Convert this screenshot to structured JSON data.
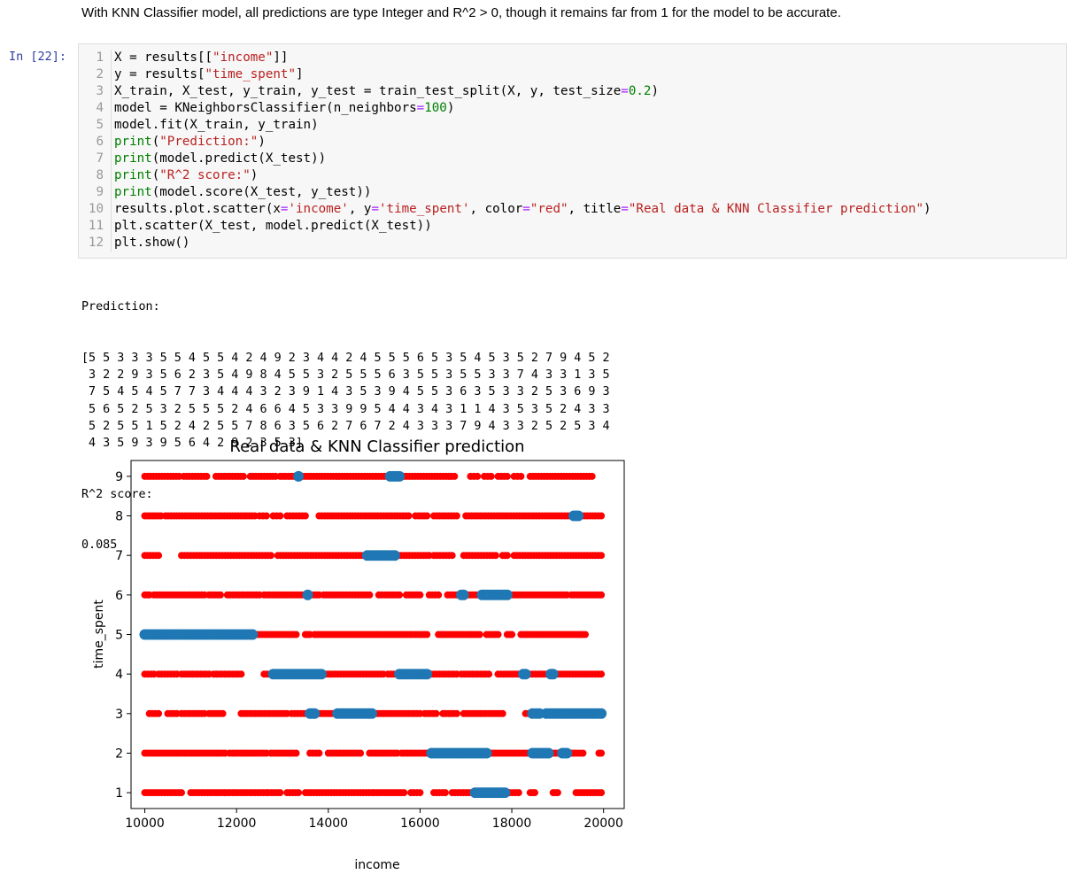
{
  "markdown": {
    "text": "With KNN Classifier model, all predictions are type Integer and R^2 > 0, though it remains far from 1 for the model to be accurate."
  },
  "cell": {
    "prompt": "In [22]:",
    "code_lines": [
      [
        [
          "X = results[[",
          ""
        ],
        [
          "\"income\"",
          "str"
        ],
        [
          "]]",
          ""
        ]
      ],
      [
        [
          "y = results[",
          ""
        ],
        [
          "\"time_spent\"",
          "str"
        ],
        [
          "]",
          ""
        ]
      ],
      [
        [
          "X_train, X_test, y_train, y_test = train_test_split(X, y, test_size",
          ""
        ],
        [
          "=",
          "op"
        ],
        [
          "0.2",
          "num"
        ],
        [
          ")",
          ""
        ]
      ],
      [
        [
          "model = KNeighborsClassifier(n_neighbors",
          ""
        ],
        [
          "=",
          "op"
        ],
        [
          "100",
          "num"
        ],
        [
          ")",
          ""
        ]
      ],
      [
        [
          "model.fit(X_train, y_train)",
          ""
        ]
      ],
      [
        [
          "print",
          "kw"
        ],
        [
          "(",
          ""
        ],
        [
          "\"Prediction:\"",
          "str"
        ],
        [
          ")",
          ""
        ]
      ],
      [
        [
          "print",
          "kw"
        ],
        [
          "(model.predict(X_test))",
          ""
        ]
      ],
      [
        [
          "print",
          "kw"
        ],
        [
          "(",
          ""
        ],
        [
          "\"R^2 score:\"",
          "str"
        ],
        [
          ")",
          ""
        ]
      ],
      [
        [
          "print",
          "kw"
        ],
        [
          "(model.score(X_test, y_test))",
          ""
        ]
      ],
      [
        [
          "results.plot.scatter(x",
          ""
        ],
        [
          "=",
          "op"
        ],
        [
          "'income'",
          "str"
        ],
        [
          ", y",
          ""
        ],
        [
          "=",
          "op"
        ],
        [
          "'time_spent'",
          "str"
        ],
        [
          ", color",
          ""
        ],
        [
          "=",
          "op"
        ],
        [
          "\"red\"",
          "str"
        ],
        [
          ", title",
          ""
        ],
        [
          "=",
          "op"
        ],
        [
          "\"Real data & KNN Classifier prediction\"",
          "str"
        ],
        [
          ")",
          ""
        ]
      ],
      [
        [
          "plt.scatter(X_test, model.predict(X_test))",
          ""
        ]
      ],
      [
        [
          "plt.show()",
          ""
        ]
      ]
    ]
  },
  "output": {
    "label1": "Prediction:",
    "prediction_lines": [
      "[5 5 3 3 3 5 5 4 5 5 4 2 4 9 2 3 4 4 2 4 5 5 5 6 5 3 5 4 5 3 5 2 7 9 4 5 2",
      " 3 2 2 9 3 5 6 2 3 5 4 9 8 4 5 5 3 2 5 5 5 6 3 5 5 3 5 5 3 3 7 4 3 3 1 3 5",
      " 7 5 4 5 4 5 7 7 3 4 4 4 3 2 3 9 1 4 3 5 3 9 4 5 5 3 6 3 5 3 3 2 5 3 6 9 3",
      " 5 6 5 2 5 3 2 5 5 5 2 4 6 6 4 5 3 3 9 9 5 4 4 3 4 3 1 1 4 3 5 3 5 2 4 3 3",
      " 5 2 5 5 1 5 2 4 2 5 5 7 8 6 3 5 6 2 7 6 7 2 4 3 3 3 7 9 4 3 3 2 5 2 5 3 4",
      " 4 3 5 9 3 9 5 6 4 2 9 2 3 5 3]"
    ],
    "label2": "R^2 score:",
    "score": "0.085"
  },
  "chart_data": {
    "type": "scatter",
    "title": "Real data & KNN Classifier prediction",
    "xlabel": "income",
    "ylabel": "time_spent",
    "xlim": [
      9700,
      20450
    ],
    "ylim": [
      0.6,
      9.4
    ],
    "xticks": [
      "10000",
      "12000",
      "14000",
      "16000",
      "18000",
      "20000"
    ],
    "yticks": [
      "1",
      "2",
      "3",
      "4",
      "5",
      "6",
      "7",
      "8",
      "9"
    ],
    "grid": false,
    "series": [
      {
        "color": "#ff0000",
        "segments": [
          {
            "y": 9,
            "ranges": [
              [
                10000,
                10750
              ],
              [
                10850,
                11350
              ],
              [
                11550,
                12150
              ],
              [
                12300,
                12850
              ],
              [
                12950,
                16750
              ],
              [
                17100,
                17250
              ],
              [
                17400,
                17550
              ],
              [
                17700,
                17900
              ],
              [
                18050,
                18200
              ],
              [
                18400,
                19750
              ]
            ]
          },
          {
            "y": 8,
            "ranges": [
              [
                10000,
                10350
              ],
              [
                10450,
                12400
              ],
              [
                12500,
                12650
              ],
              [
                12800,
                12950
              ],
              [
                13100,
                13500
              ],
              [
                13800,
                15750
              ],
              [
                15900,
                16150
              ],
              [
                16300,
                16800
              ],
              [
                17000,
                19950
              ]
            ]
          },
          {
            "y": 7,
            "ranges": [
              [
                10000,
                10300
              ],
              [
                10800,
                11200
              ],
              [
                11250,
                12750
              ],
              [
                12900,
                13500
              ],
              [
                13550,
                16200
              ],
              [
                16300,
                16700
              ],
              [
                16950,
                17650
              ],
              [
                17800,
                17900
              ],
              [
                18050,
                19950
              ]
            ]
          },
          {
            "y": 6,
            "ranges": [
              [
                10000,
                10100
              ],
              [
                10200,
                11300
              ],
              [
                11400,
                11650
              ],
              [
                11800,
                12500
              ],
              [
                12600,
                13800
              ],
              [
                13900,
                14900
              ],
              [
                15100,
                15550
              ],
              [
                15700,
                16000
              ],
              [
                16200,
                16400
              ],
              [
                16600,
                19200
              ],
              [
                19300,
                19950
              ]
            ]
          },
          {
            "y": 5,
            "ranges": [
              [
                10000,
                13300
              ],
              [
                13500,
                13600
              ],
              [
                13700,
                16150
              ],
              [
                16400,
                17300
              ],
              [
                17450,
                17700
              ],
              [
                17900,
                18000
              ],
              [
                18200,
                19600
              ]
            ]
          },
          {
            "y": 4,
            "ranges": [
              [
                10000,
                10200
              ],
              [
                10300,
                10700
              ],
              [
                10800,
                11400
              ],
              [
                11500,
                12100
              ],
              [
                12600,
                15200
              ],
              [
                15300,
                16800
              ],
              [
                16900,
                17500
              ],
              [
                17700,
                19950
              ]
            ]
          },
          {
            "y": 3,
            "ranges": [
              [
                10100,
                10300
              ],
              [
                10500,
                10700
              ],
              [
                10800,
                11300
              ],
              [
                11400,
                11700
              ],
              [
                12100,
                13100
              ],
              [
                13200,
                13600
              ],
              [
                13700,
                16000
              ],
              [
                16100,
                16350
              ],
              [
                16500,
                16800
              ],
              [
                16950,
                17800
              ],
              [
                18300,
                19950
              ]
            ]
          },
          {
            "y": 2,
            "ranges": [
              [
                10000,
                11750
              ],
              [
                11850,
                12650
              ],
              [
                12750,
                13300
              ],
              [
                13600,
                13800
              ],
              [
                14000,
                14700
              ],
              [
                14900,
                15500
              ],
              [
                15600,
                17400
              ],
              [
                17500,
                18400
              ],
              [
                18700,
                19550
              ],
              [
                19900,
                19950
              ]
            ]
          },
          {
            "y": 1,
            "ranges": [
              [
                10000,
                10800
              ],
              [
                11000,
                12650
              ],
              [
                12700,
                12950
              ],
              [
                13100,
                13350
              ],
              [
                13500,
                14950
              ],
              [
                15000,
                15650
              ],
              [
                15800,
                16000
              ],
              [
                16300,
                16550
              ],
              [
                16700,
                17750
              ],
              [
                17950,
                18150
              ],
              [
                18400,
                18500
              ],
              [
                18900,
                19000
              ],
              [
                19400,
                19950
              ]
            ]
          }
        ]
      },
      {
        "color": "#1f77b4",
        "segments": [
          {
            "y": 9,
            "ranges": [
              [
                13350,
                13350
              ],
              [
                15350,
                15550
              ]
            ]
          },
          {
            "y": 8,
            "ranges": [
              [
                19350,
                19450
              ]
            ]
          },
          {
            "y": 7,
            "ranges": [
              [
                14850,
                15450
              ]
            ]
          },
          {
            "y": 6,
            "ranges": [
              [
                13550,
                13550
              ],
              [
                16900,
                16950
              ],
              [
                17350,
                17900
              ]
            ]
          },
          {
            "y": 5,
            "ranges": [
              [
                10000,
                12350
              ]
            ]
          },
          {
            "y": 4,
            "ranges": [
              [
                12800,
                13850
              ],
              [
                15550,
                16150
              ],
              [
                18250,
                18300
              ],
              [
                18850,
                18900
              ]
            ]
          },
          {
            "y": 3,
            "ranges": [
              [
                13600,
                13700
              ],
              [
                14200,
                14950
              ],
              [
                18450,
                18600
              ],
              [
                18750,
                19950
              ]
            ]
          },
          {
            "y": 2,
            "ranges": [
              [
                16250,
                17450
              ],
              [
                18450,
                18800
              ],
              [
                19100,
                19200
              ]
            ]
          },
          {
            "y": 1,
            "ranges": [
              [
                17200,
                17850
              ]
            ]
          }
        ]
      }
    ]
  }
}
